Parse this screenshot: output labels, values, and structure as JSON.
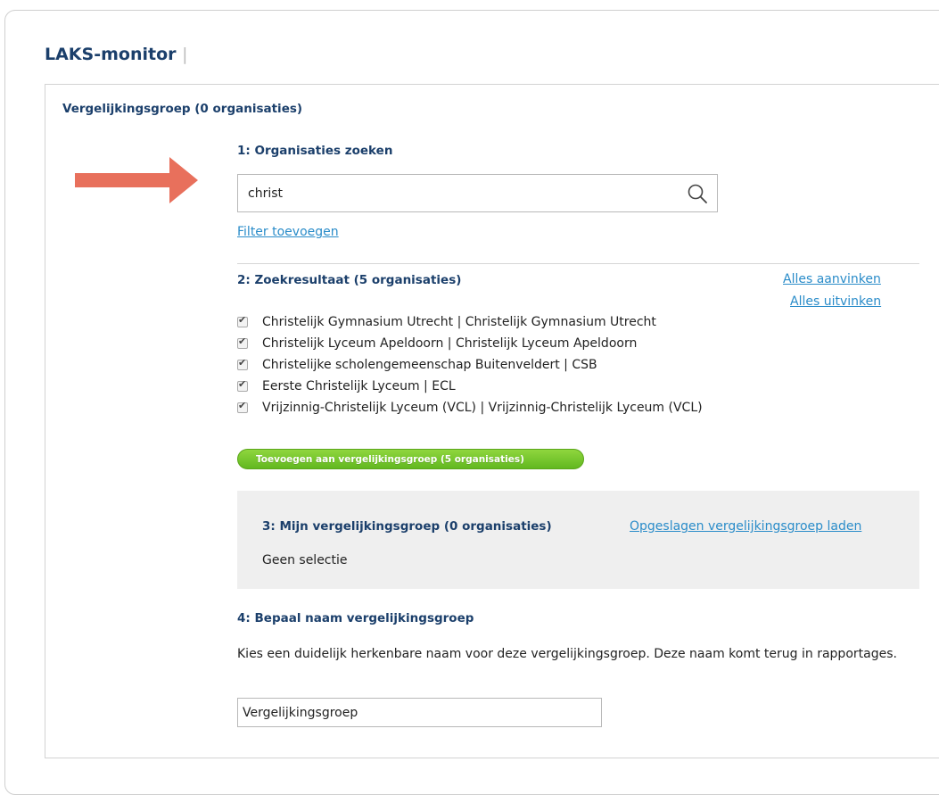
{
  "app": {
    "title": "LAKS-monitor",
    "title_caret": "|"
  },
  "panel": {
    "header": "Vergelijkingsgroep (0 organisaties)"
  },
  "step1": {
    "heading": "1: Organisaties zoeken",
    "search_value": "christ",
    "search_icon": "search-icon",
    "filter_link": "Filter toevoegen"
  },
  "annotation": {
    "arrow_color": "#e8705c"
  },
  "step2": {
    "heading": "2: Zoekresultaat (5 organisaties)",
    "check_all": "Alles aanvinken",
    "uncheck_all": "Alles uitvinken",
    "results": [
      {
        "label": "Christelijk Gymnasium Utrecht | Christelijk Gymnasium Utrecht",
        "checked": true
      },
      {
        "label": "Christelijk Lyceum Apeldoorn | Christelijk Lyceum Apeldoorn",
        "checked": true
      },
      {
        "label": "Christelijke scholengemeenschap Buitenveldert | CSB",
        "checked": true
      },
      {
        "label": "Eerste Christelijk Lyceum | ECL",
        "checked": true
      },
      {
        "label": "Vrijzinnig-Christelijk Lyceum (VCL) | Vrijzinnig-Christelijk Lyceum (VCL)",
        "checked": true
      }
    ],
    "add_button": "Toevoegen aan vergelijkingsgroep (5 organisaties)"
  },
  "step3": {
    "heading": "3: Mijn vergelijkingsgroep (0 organisaties)",
    "load_link": "Opgeslagen vergelijkingsgroep laden",
    "empty_text": "Geen selectie"
  },
  "step4": {
    "heading": "4: Bepaal naam vergelijkingsgroep",
    "description": "Kies een duidelijk herkenbare naam voor deze vergelijkingsgroep. Deze naam komt terug in rapportages.",
    "name_value": "Vergelijkingsgroep"
  },
  "colors": {
    "heading": "#1b3f6b",
    "link": "#2a8cc9",
    "button": "#62b820",
    "arrow": "#e8705c"
  }
}
